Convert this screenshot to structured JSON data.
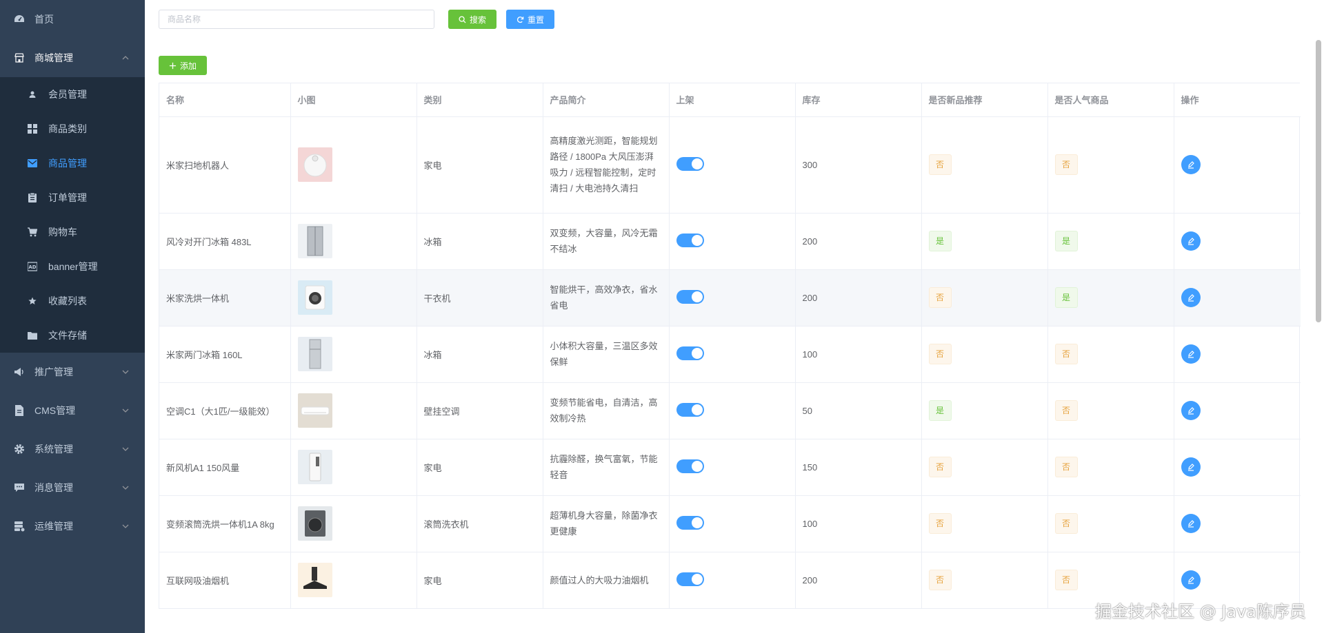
{
  "sidebar": {
    "home": "首页",
    "mall": "商城管理",
    "sub_items": [
      "会员管理",
      "商品类别",
      "商品管理",
      "订单管理",
      "购物车",
      "banner管理",
      "收藏列表",
      "文件存储"
    ],
    "promo": "推广管理",
    "cms": "CMS管理",
    "system": "系统管理",
    "message": "消息管理",
    "ops": "运维管理"
  },
  "search": {
    "placeholder": "商品名称",
    "search_label": "搜索",
    "reset_label": "重置"
  },
  "toolbar": {
    "add_label": "添加"
  },
  "table": {
    "headers": [
      "名称",
      "小图",
      "类别",
      "产品简介",
      "上架",
      "库存",
      "是否新品推荐",
      "是否人气商品",
      "操作"
    ],
    "rows": [
      {
        "name": "米家扫地机器人",
        "category": "家电",
        "desc": "高精度激光测距，智能规划路径 / 1800Pa 大风压澎湃吸力 / 远程智能控制，定时清扫 / 大电池持久清扫",
        "on_shelf": true,
        "stock": "300",
        "is_new": "否",
        "is_hot": "否"
      },
      {
        "name": "风冷对开门冰箱 483L",
        "category": "冰箱",
        "desc": "双变频，大容量，风冷无霜不结冰",
        "on_shelf": true,
        "stock": "200",
        "is_new": "是",
        "is_hot": "是"
      },
      {
        "name": "米家洗烘一体机",
        "category": "干衣机",
        "desc": "智能烘干，高效净衣，省水省电",
        "on_shelf": true,
        "stock": "200",
        "is_new": "否",
        "is_hot": "是"
      },
      {
        "name": "米家两门冰箱 160L",
        "category": "冰箱",
        "desc": "小体积大容量，三温区多效保鲜",
        "on_shelf": true,
        "stock": "100",
        "is_new": "否",
        "is_hot": "否"
      },
      {
        "name": "空调C1（大1匹/一级能效）",
        "category": "壁挂空调",
        "desc": "变频节能省电，自清洁，高效制冷热",
        "on_shelf": true,
        "stock": "50",
        "is_new": "是",
        "is_hot": "否"
      },
      {
        "name": "新风机A1 150风量",
        "category": "家电",
        "desc": "抗霾除醛，换气富氧，节能轻音",
        "on_shelf": true,
        "stock": "150",
        "is_new": "否",
        "is_hot": "否"
      },
      {
        "name": "变频滚筒洗烘一体机1A 8kg",
        "category": "滚筒洗衣机",
        "desc": "超薄机身大容量，除菌净衣更健康",
        "on_shelf": true,
        "stock": "100",
        "is_new": "否",
        "is_hot": "否"
      },
      {
        "name": "互联网吸油烟机",
        "category": "家电",
        "desc": "颜值过人的大吸力油烟机",
        "on_shelf": true,
        "stock": "200",
        "is_new": "否",
        "is_hot": "否"
      }
    ]
  },
  "watermark": "掘金技术社区 @ Java陈序员",
  "colors": {
    "sidebar_bg": "#304156",
    "submenu_bg": "#1f2d3d",
    "primary": "#409eff",
    "success": "#67c23a",
    "warning": "#e6a23c"
  }
}
